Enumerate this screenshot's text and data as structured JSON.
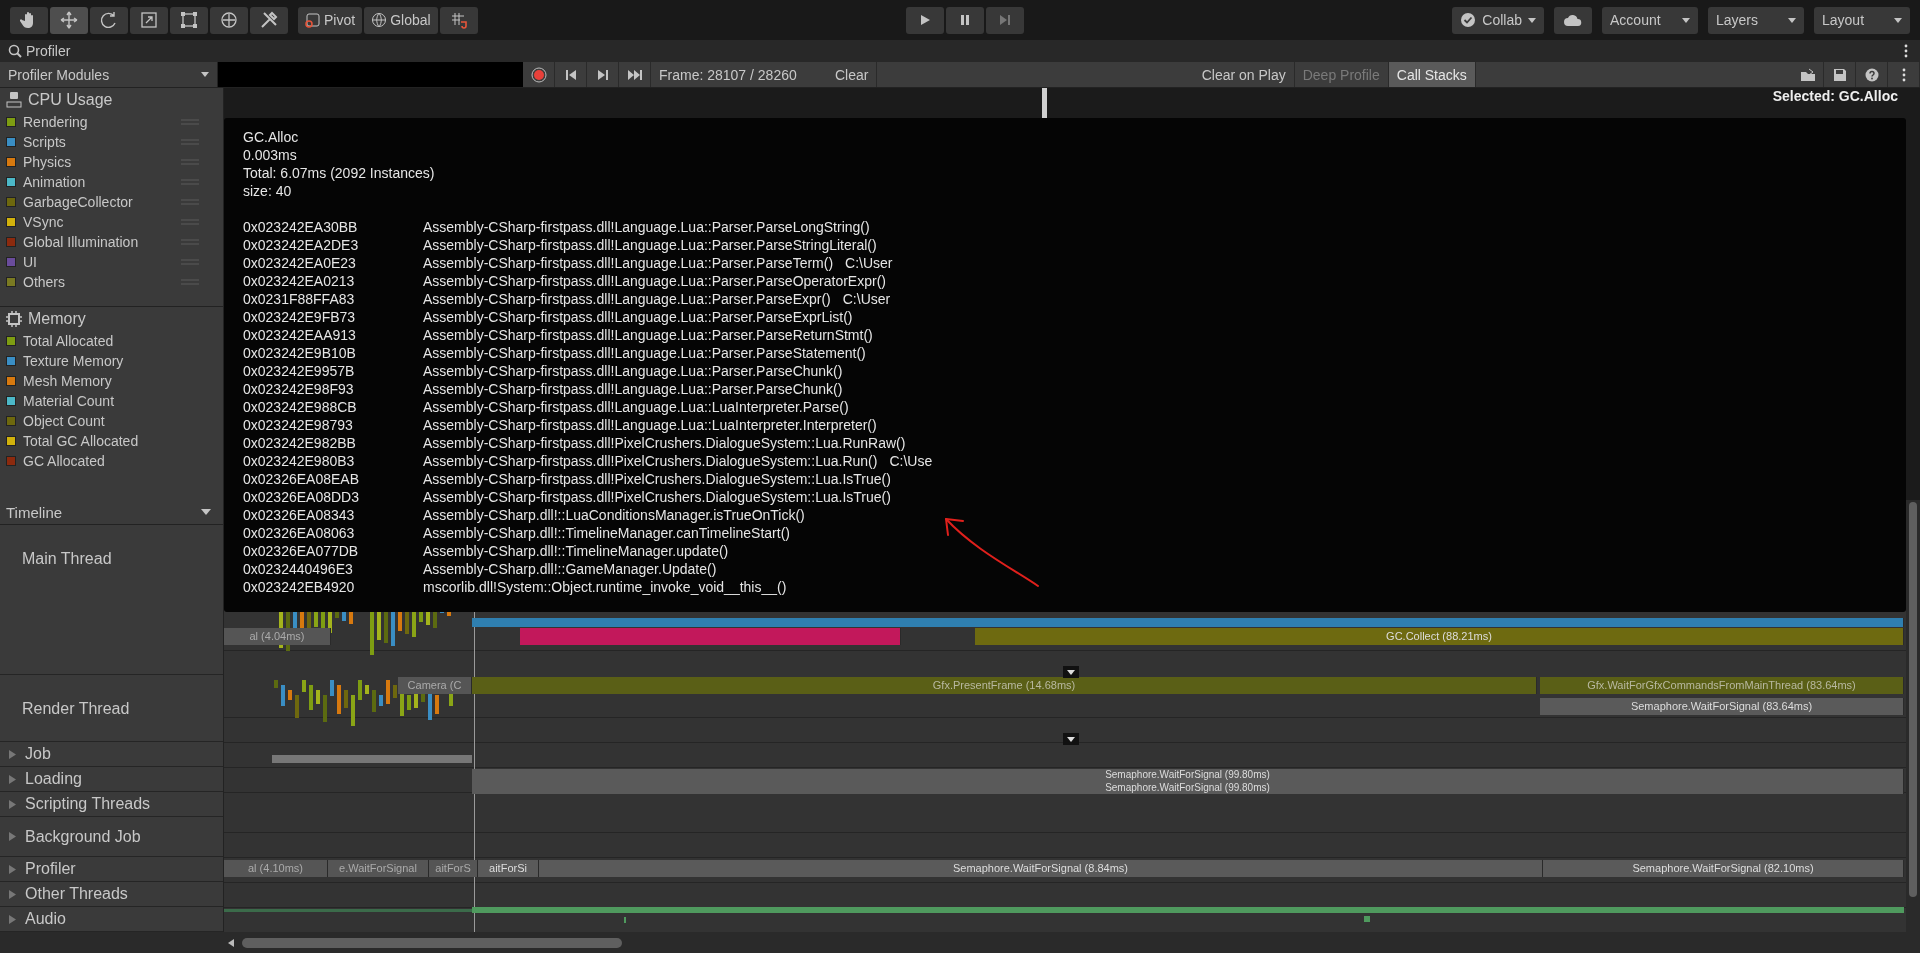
{
  "toolbar": {
    "tools": [
      {
        "kind": "hand",
        "selected": false
      },
      {
        "kind": "move",
        "selected": true
      },
      {
        "kind": "rotate",
        "selected": false
      },
      {
        "kind": "scale",
        "selected": false
      },
      {
        "kind": "rect",
        "selected": false
      },
      {
        "kind": "transform",
        "selected": false
      },
      {
        "kind": "custom",
        "selected": false
      }
    ],
    "pivot": "Pivot",
    "global": "Global",
    "collab": "Collab",
    "account": "Account",
    "layers": "Layers",
    "layout": "Layout"
  },
  "tab": {
    "title": "Profiler"
  },
  "profiler_toolbar": {
    "modules": "Profiler Modules",
    "recording": true,
    "frame": "Frame: 28107 / 28260",
    "clear": "Clear",
    "toggles": [
      {
        "label": "Clear on Play",
        "selected": false,
        "disabled": false
      },
      {
        "label": "Deep Profile",
        "selected": false,
        "disabled": true
      },
      {
        "label": "Call Stacks",
        "selected": true,
        "disabled": false
      }
    ]
  },
  "modules": [
    {
      "title": "CPU Usage",
      "kind": "cpu",
      "items": [
        {
          "label": "Rendering",
          "color": "#7e9d12"
        },
        {
          "label": "Scripts",
          "color": "#3a8ec4"
        },
        {
          "label": "Physics",
          "color": "#d7790f"
        },
        {
          "label": "Animation",
          "color": "#4cb8c8"
        },
        {
          "label": "GarbageCollector",
          "color": "#6e680e"
        },
        {
          "label": "VSync",
          "color": "#d2b20c"
        },
        {
          "label": "Global Illumination",
          "color": "#8c2a0e"
        },
        {
          "label": "UI",
          "color": "#6a4c9c"
        },
        {
          "label": "Others",
          "color": "#7a7a22"
        }
      ]
    },
    {
      "title": "Memory",
      "kind": "memory",
      "items": [
        {
          "label": "Total Allocated",
          "color": "#7e9d12"
        },
        {
          "label": "Texture Memory",
          "color": "#3a8ec4"
        },
        {
          "label": "Mesh Memory",
          "color": "#d7790f"
        },
        {
          "label": "Material Count",
          "color": "#4cb8c8"
        },
        {
          "label": "Object Count",
          "color": "#6e680e"
        },
        {
          "label": "Total GC Allocated",
          "color": "#d2b20c"
        },
        {
          "label": "GC Allocated",
          "color": "#8c2a0e"
        }
      ]
    }
  ],
  "chart": {
    "selected": "Selected: GC.Alloc"
  },
  "timeline": {
    "title": "Timeline",
    "threads": [
      {
        "label": "Main Thread",
        "kind": "thread"
      },
      {
        "label": "Render Thread",
        "kind": "thread"
      },
      {
        "label": "Job",
        "kind": "group",
        "expanded": false
      },
      {
        "label": "Loading",
        "kind": "group",
        "expanded": false
      },
      {
        "label": "Scripting Threads",
        "kind": "group",
        "expanded": false
      },
      {
        "label": "Background Job",
        "kind": "group",
        "expanded": false
      },
      {
        "label": "Profiler",
        "kind": "group",
        "expanded": false
      },
      {
        "label": "Other Threads",
        "kind": "group",
        "expanded": false
      },
      {
        "label": "Audio",
        "kind": "group",
        "expanded": false
      }
    ],
    "bars": [
      {
        "kind": "script"
      },
      {
        "kind": "idle",
        "label": "al (4.04ms)"
      },
      {
        "kind": "alloc"
      },
      {
        "kind": "gc",
        "label": "GC.Collect (88.21ms)"
      },
      {
        "kind": "idle",
        "label": "Camera (C"
      },
      {
        "kind": "render",
        "label": "Gfx.PresentFrame (14.68ms)"
      },
      {
        "kind": "render",
        "label": "Gfx.WaitForGfxCommandsFromMainThread (83.64ms)"
      },
      {
        "kind": "wait",
        "label": "Semaphore.WaitForSignal (83.64ms)"
      },
      {
        "kind": "wait",
        "label": "Semaphore.WaitForSignal (99.80ms)"
      },
      {
        "kind": "wait",
        "label": "Semaphore.WaitForSignal (99.80ms)"
      },
      {
        "kind": "idle",
        "label": "al (4.10ms)"
      },
      {
        "kind": "idle",
        "label": "e.WaitForSignal"
      },
      {
        "kind": "idle",
        "label": "aitForS"
      },
      {
        "kind": "wait",
        "label": "aitForSi"
      },
      {
        "kind": "wait",
        "label": "Semaphore.WaitForSignal (8.84ms)"
      },
      {
        "kind": "wait",
        "label": "Semaphore.WaitForSignal (82.10ms)"
      }
    ]
  },
  "tooltip": {
    "lines": [
      "GC.Alloc",
      "0.003ms",
      "Total: 6.07ms (2092 Instances)",
      "size: 40"
    ],
    "frames": [
      {
        "address": "0x023242EA30BB",
        "symbol": "Assembly-CSharp-firstpass.dll!Language.Lua::Parser.ParseLongString()"
      },
      {
        "address": "0x023242EA2DE3",
        "symbol": "Assembly-CSharp-firstpass.dll!Language.Lua::Parser.ParseStringLiteral()"
      },
      {
        "address": "0x023242EA0E23",
        "symbol": "Assembly-CSharp-firstpass.dll!Language.Lua::Parser.ParseTerm()",
        "location": "C:\\User"
      },
      {
        "address": "0x023242EA0213",
        "symbol": "Assembly-CSharp-firstpass.dll!Language.Lua::Parser.ParseOperatorExpr()"
      },
      {
        "address": "0x0231F88FFA83",
        "symbol": "Assembly-CSharp-firstpass.dll!Language.Lua::Parser.ParseExpr()",
        "location": "C:\\User"
      },
      {
        "address": "0x023242E9FB73",
        "symbol": "Assembly-CSharp-firstpass.dll!Language.Lua::Parser.ParseExprList()"
      },
      {
        "address": "0x023242EAA913",
        "symbol": "Assembly-CSharp-firstpass.dll!Language.Lua::Parser.ParseReturnStmt()"
      },
      {
        "address": "0x023242E9B10B",
        "symbol": "Assembly-CSharp-firstpass.dll!Language.Lua::Parser.ParseStatement()"
      },
      {
        "address": "0x023242E9957B",
        "symbol": "Assembly-CSharp-firstpass.dll!Language.Lua::Parser.ParseChunk()"
      },
      {
        "address": "0x023242E98F93",
        "symbol": "Assembly-CSharp-firstpass.dll!Language.Lua::Parser.ParseChunk()"
      },
      {
        "address": "0x023242E988CB",
        "symbol": "Assembly-CSharp-firstpass.dll!Language.Lua::LuaInterpreter.Parse()"
      },
      {
        "address": "0x023242E98793",
        "symbol": "Assembly-CSharp-firstpass.dll!Language.Lua::LuaInterpreter.Interpreter()"
      },
      {
        "address": "0x023242E982BB",
        "symbol": "Assembly-CSharp-firstpass.dll!PixelCrushers.DialogueSystem::Lua.RunRaw()"
      },
      {
        "address": "0x023242E980B3",
        "symbol": "Assembly-CSharp-firstpass.dll!PixelCrushers.DialogueSystem::Lua.Run()",
        "location": "C:\\Use"
      },
      {
        "address": "0x02326EA08EAB",
        "symbol": "Assembly-CSharp-firstpass.dll!PixelCrushers.DialogueSystem::Lua.IsTrue()"
      },
      {
        "address": "0x02326EA08DD3",
        "symbol": "Assembly-CSharp-firstpass.dll!PixelCrushers.DialogueSystem::Lua.IsTrue()"
      },
      {
        "address": "0x02326EA08343",
        "symbol": "Assembly-CSharp.dll!::LuaConditionsManager.isTrueOnTick()"
      },
      {
        "address": "0x02326EA08063",
        "symbol": "Assembly-CSharp.dll!::TimelineManager.canTimelineStart()"
      },
      {
        "address": "0x02326EA077DB",
        "symbol": "Assembly-CSharp.dll!::TimelineManager.update()"
      },
      {
        "address": "0x0232440496E3",
        "symbol": "Assembly-CSharp.dll!::GameManager.Update()"
      },
      {
        "address": "0x023242EB4920",
        "symbol": "mscorlib.dll!System::Object.runtime_invoke_void__this__()"
      }
    ]
  }
}
